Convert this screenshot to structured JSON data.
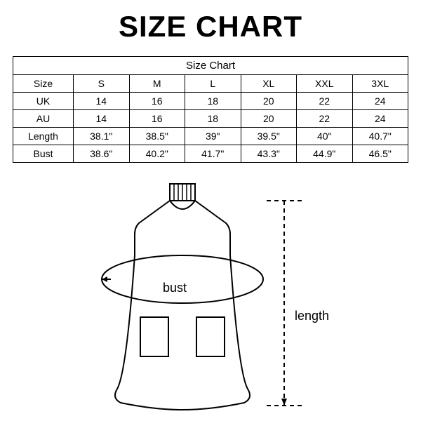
{
  "title": "SIZE CHART",
  "table": {
    "header": "Size Chart",
    "row_labels": [
      "Size",
      "UK",
      "AU",
      "Length",
      "Bust"
    ],
    "rows": {
      "size": [
        "S",
        "M",
        "L",
        "XL",
        "XXL",
        "3XL"
      ],
      "uk": [
        "14",
        "16",
        "18",
        "20",
        "22",
        "24"
      ],
      "au": [
        "14",
        "16",
        "18",
        "20",
        "22",
        "24"
      ],
      "length": [
        "38.1\"",
        "38.5\"",
        "39\"",
        "39.5\"",
        "40\"",
        "40.7\""
      ],
      "bust": [
        "38.6\"",
        "40.2\"",
        "41.7\"",
        "43.3\"",
        "44.9\"",
        "46.5\""
      ]
    }
  },
  "diagram": {
    "bust_label": "bust",
    "length_label": "length"
  },
  "chart_data": {
    "type": "table",
    "title": "Size Chart",
    "columns": [
      "Size",
      "S",
      "M",
      "L",
      "XL",
      "XXL",
      "3XL"
    ],
    "rows": [
      {
        "label": "UK",
        "values": [
          14,
          16,
          18,
          20,
          22,
          24
        ]
      },
      {
        "label": "AU",
        "values": [
          14,
          16,
          18,
          20,
          22,
          24
        ]
      },
      {
        "label": "Length (in)",
        "values": [
          38.1,
          38.5,
          39.0,
          39.5,
          40.0,
          40.7
        ]
      },
      {
        "label": "Bust (in)",
        "values": [
          38.6,
          40.2,
          41.7,
          43.3,
          44.9,
          46.5
        ]
      }
    ]
  }
}
